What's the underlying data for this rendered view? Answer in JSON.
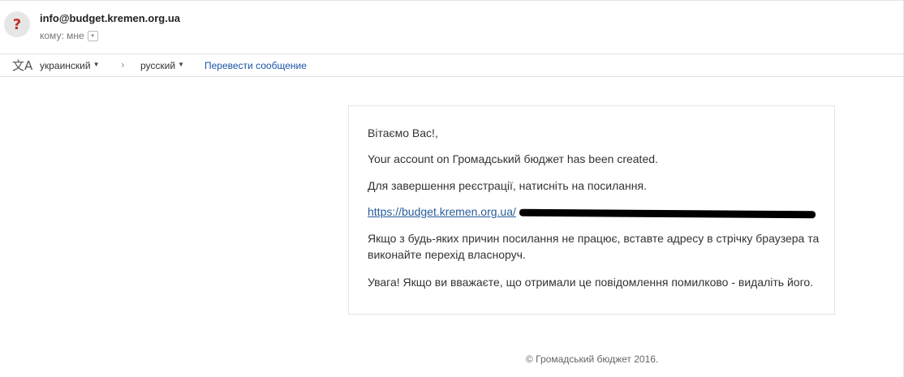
{
  "header": {
    "avatar_glyph": "?",
    "sender": "info@budget.kremen.org.ua",
    "to_label": "кому: мне",
    "to_dropdown_glyph": "▾"
  },
  "translate_bar": {
    "icon_glyph": "文A",
    "from_lang": "украинский",
    "arrow": "›",
    "to_lang": "русский",
    "caret": "▼",
    "action": "Перевести сообщение"
  },
  "message": {
    "greeting": "Вітаємо Вас!,",
    "account_line": "Your account on Громадський бюджет has been created.",
    "complete_line": "Для завершення реєстрації, натисніть на посилання.",
    "link_text": "https://budget.kremen.org.ua/",
    "broken_link_line": "Якщо з будь-яких причин посилання не працює, вставте адресу в стрічку браузера та виконайте перехід власноруч.",
    "warning_line": "Увага! Якщо ви вважаєте, що отримали це повідомлення помилково - видаліть його."
  },
  "footer": {
    "copyright": "© Громадський бюджет 2016."
  },
  "colors": {
    "link": "#2a5d99",
    "translate_link": "#1a54a8",
    "avatar_mark": "#c2302b"
  }
}
